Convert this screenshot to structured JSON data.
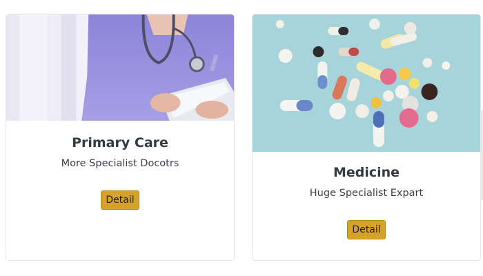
{
  "cards": [
    {
      "title": "Primary Care",
      "subtitle": "More Specialist Docotrs",
      "button_label": "Detail",
      "image_icon": "doctor-with-tablet-image"
    },
    {
      "title": "Medicine",
      "subtitle": "Huge Specialist Expart",
      "button_label": "Detail",
      "image_icon": "pills-image"
    }
  ],
  "colors": {
    "button_bg": "#d7a22a",
    "title": "#343a40",
    "card_border": "#e3e6ea"
  }
}
